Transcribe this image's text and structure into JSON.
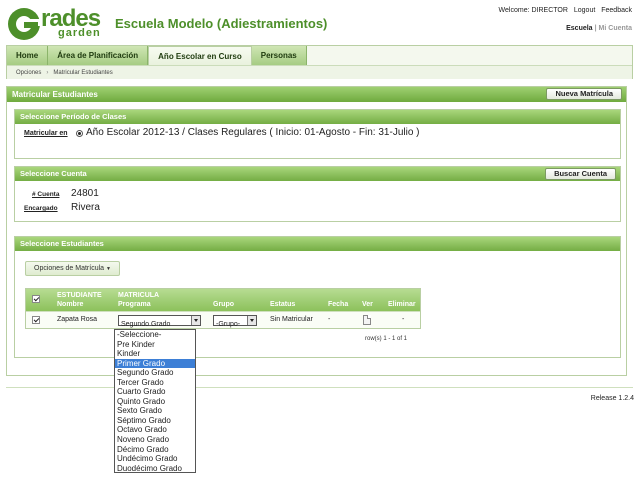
{
  "logo": {
    "word": "rades",
    "sub": "garden"
  },
  "school_title": "Escuela Modelo (Adiestramientos)",
  "top_links": {
    "welcome": "Welcome: DIRECTOR",
    "logout": "Logout",
    "feedback": "Feedback"
  },
  "sub_links": {
    "escuela": "Escuela",
    "separator": "|",
    "mi_cuenta": "Mi Cuenta"
  },
  "nav": {
    "tabs": [
      {
        "label": "Home",
        "active": false
      },
      {
        "label": "Área de Planificación",
        "active": false
      },
      {
        "label": "Año Escolar en Curso",
        "active": true
      },
      {
        "label": "Personas",
        "active": false
      }
    ],
    "breadcrumb": [
      "Opciones",
      "Matricular Estudiantes"
    ],
    "breadcrumb_sep": "›"
  },
  "main": {
    "title": "Matricular Estudiantes",
    "new_button": "Nueva Matrícula",
    "period": {
      "title": "Seleccione Período de Clases",
      "label": "Matricular en",
      "value": "Año Escolar 2012-13 / Clases Regulares ( Inicio: 01-Agosto - Fin: 31-Julio )"
    },
    "account": {
      "title": "Seleccione Cuenta",
      "search_button": "Buscar Cuenta",
      "account_label": "# Cuenta",
      "account_value": "24801",
      "guardian_label": "Encargado",
      "guardian_value": "Rivera"
    },
    "students": {
      "title": "Seleccione Estudiantes",
      "options_button": "Opciones de Matrícula",
      "columns": {
        "estudiante": "ESTUDIANTE",
        "nombre": "Nombre",
        "matricula": "MATRICULA",
        "programa": "Programa",
        "grupo": "Grupo",
        "estatus": "Estatus",
        "fecha": "Fecha",
        "ver": "Ver",
        "eliminar": "Eliminar"
      },
      "rows": [
        {
          "name": "Zapata Rosa",
          "programa": "Segundo Grado",
          "grupo": "-Grupo-",
          "estatus": "Sin Matricular",
          "fecha": "-",
          "eliminar": "-"
        }
      ],
      "row_count": "row(s) 1 - 1 of 1"
    }
  },
  "dropdown_options": [
    "-Seleccione-",
    "Pre Kinder",
    "Kinder",
    "Primer Grado",
    "Segundo Grado",
    "Tercer Grado",
    "Cuarto Grado",
    "Quinto Grado",
    "Sexto Grado",
    "Séptimo Grado",
    "Octavo Grado",
    "Noveno Grado",
    "Décimo Grado",
    "Undécimo Grado",
    "Duodécimo Grado"
  ],
  "dropdown_highlighted": "Primer Grado",
  "release": "Release 1.2.4",
  "colors": {
    "brand_green": "#4d8f2a",
    "header_green": "#74ad44",
    "highlight_blue": "#3d7fd6"
  },
  "icons": {
    "logo": "grades-logo-g",
    "view": "document-icon",
    "dropdown": "caret-down-icon"
  }
}
